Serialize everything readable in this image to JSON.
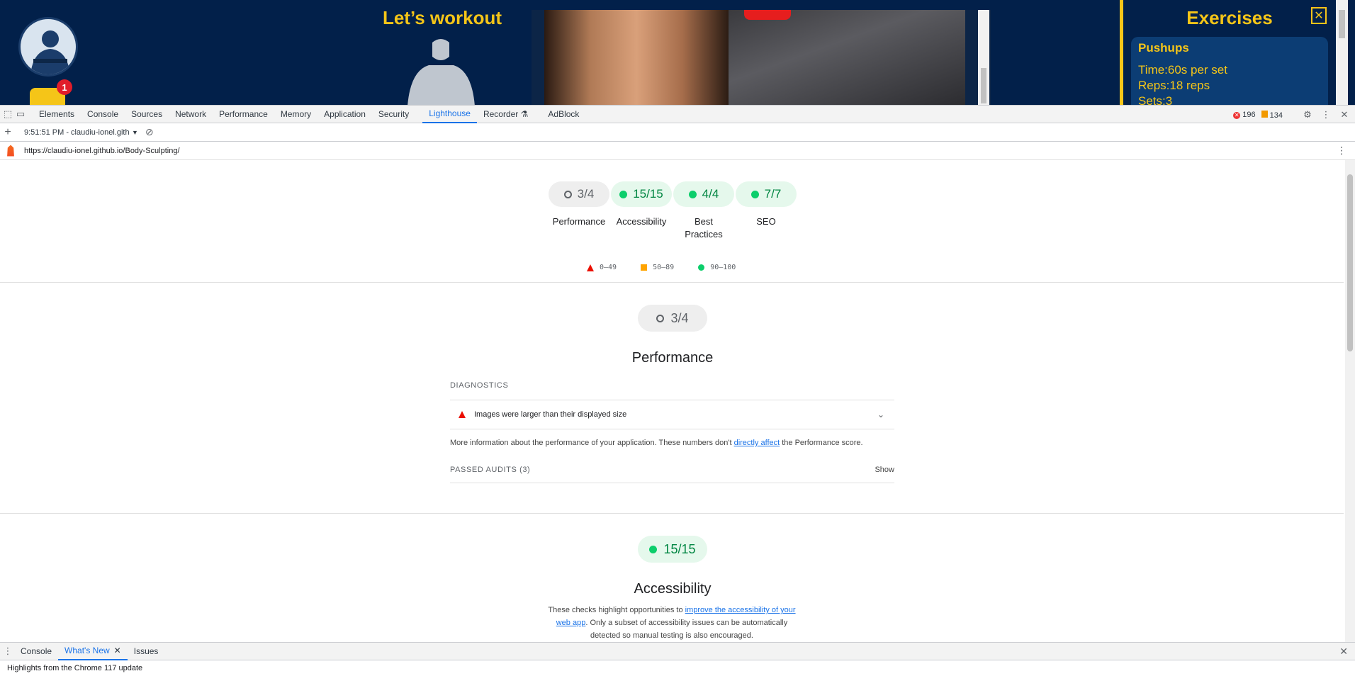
{
  "site": {
    "title": "Let’s workout",
    "cart_badge": "1",
    "exercises_title": "Exercises",
    "close_glyph": "✕",
    "card": {
      "name": "Pushups",
      "time": "Time:60s per set",
      "reps": "Reps:18 reps",
      "sets": "Sets:3"
    }
  },
  "devtools": {
    "tabs": [
      "Elements",
      "Console",
      "Sources",
      "Network",
      "Performance",
      "Memory",
      "Application",
      "Security",
      "Lighthouse",
      "Recorder ⚗",
      "AdBlock"
    ],
    "active_tab": "Lighthouse",
    "errors": "196",
    "warnings": "134",
    "report_select": "9:51:51 PM - claudiu-ionel.gith",
    "url": "https://claudiu-ionel.github.io/Body-Sculpting/"
  },
  "report": {
    "gauges": [
      {
        "score": "3/4",
        "label": "Performance",
        "status": "neutral"
      },
      {
        "score": "15/15",
        "label": "Accessibility",
        "status": "pass"
      },
      {
        "score": "4/4",
        "label": "Best Practices",
        "status": "pass"
      },
      {
        "score": "7/7",
        "label": "SEO",
        "status": "pass"
      }
    ],
    "legend": {
      "low": "0–49",
      "mid": "50–89",
      "high": "90–100"
    },
    "performance": {
      "score": "3/4",
      "title": "Performance",
      "diagnostics_label": "DIAGNOSTICS",
      "audit": "Images were larger than their displayed size",
      "desc_before": "More information about the performance of your application. These numbers don't ",
      "desc_link": "directly affect",
      "desc_after": " the Performance score.",
      "passed_label": "PASSED AUDITS",
      "passed_count": "(3)",
      "show_label": "Show"
    },
    "accessibility": {
      "score": "15/15",
      "title": "Accessibility",
      "desc_before": "These checks highlight opportunities to ",
      "desc_link": "improve the accessibility of your web app",
      "desc_after": ". Only a subset of accessibility issues can be automatically detected so manual testing is also encouraged."
    }
  },
  "drawer": {
    "tabs": [
      "Console",
      "What's New",
      "Issues"
    ],
    "active_tab": "What's New",
    "body": "Highlights from the Chrome 117 update"
  },
  "colors": {
    "accent": "#1a73e8",
    "pass": "#0cce6b",
    "average": "#ffa400",
    "fail": "#eb0f00",
    "site_bg": "#02204a",
    "site_accent": "#f5c518"
  }
}
